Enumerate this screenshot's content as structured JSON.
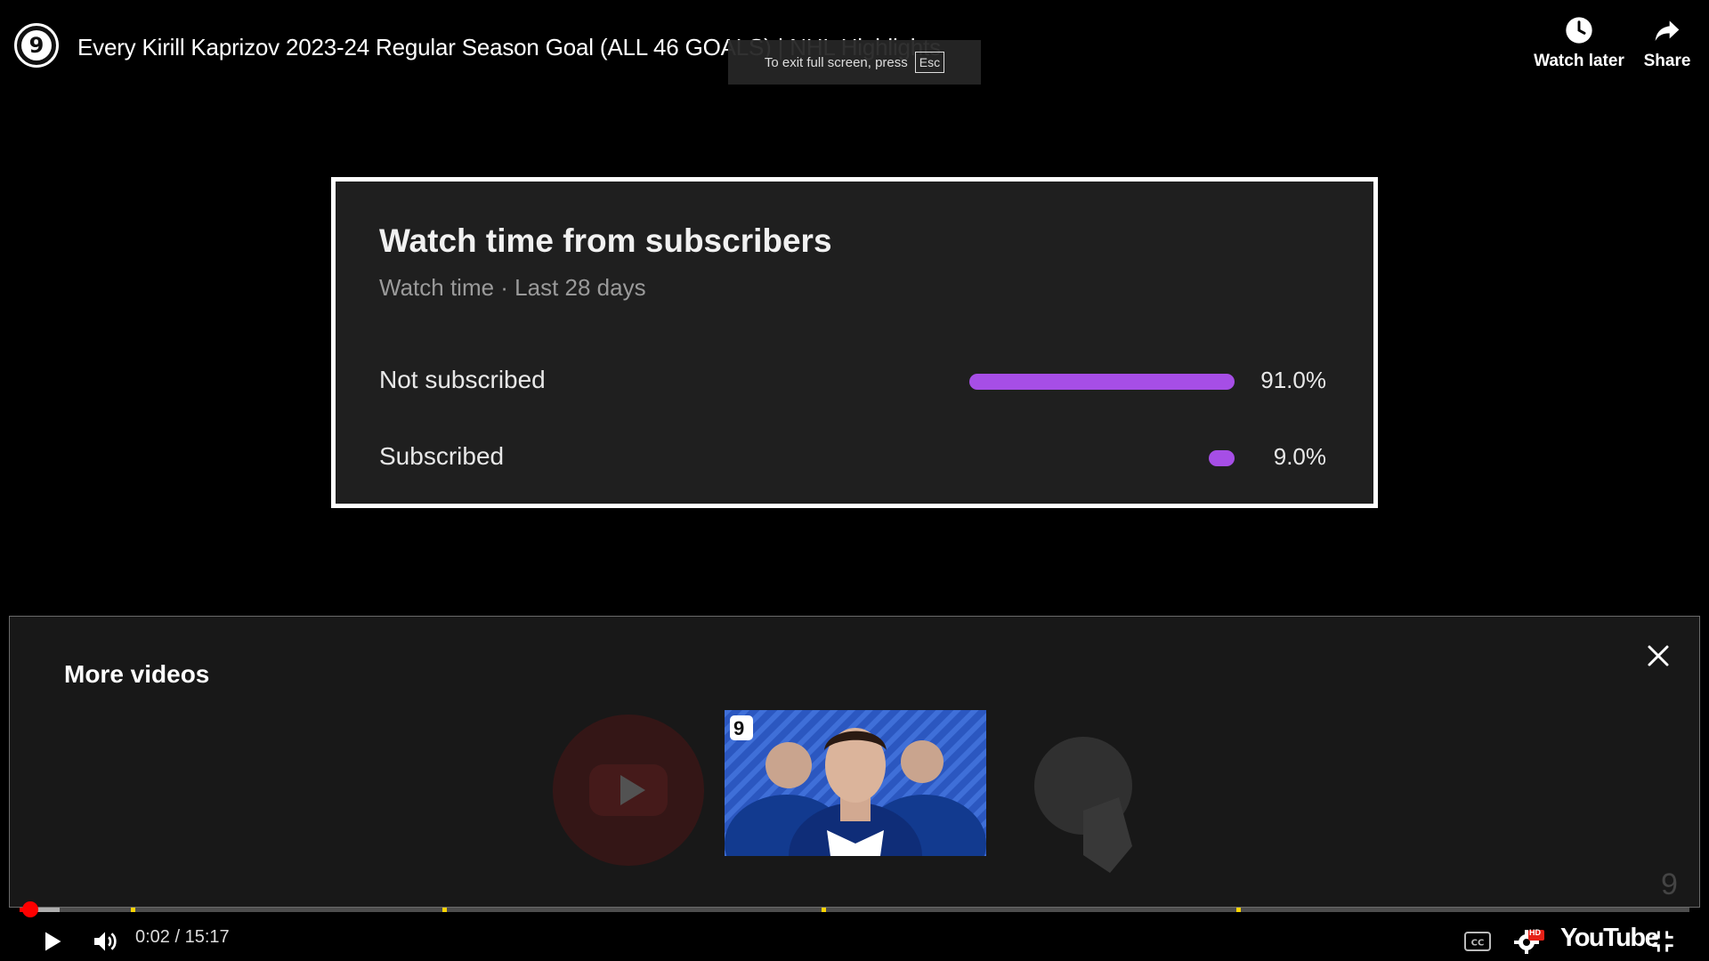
{
  "header": {
    "channel_logo_digit": "9",
    "video_title": "Every Kirill Kaprizov 2023-24 Regular Season Goal (ALL 46 GOALS) | NHL Highlights",
    "watch_later_label": "Watch later",
    "share_label": "Share"
  },
  "toast": {
    "text": "To exit full screen, press",
    "key": "Esc"
  },
  "stat_card": {
    "title": "Watch time from subscribers",
    "subtitle": "Watch time · Last 28 days",
    "rows": [
      {
        "label": "Not subscribed",
        "value": "91.0%",
        "fraction": 0.91
      },
      {
        "label": "Subscribed",
        "value": "9.0%",
        "fraction": 0.09
      }
    ],
    "bar_color": "#a64ee6"
  },
  "more_videos": {
    "title": "More videos",
    "thumbnail_badge": "9",
    "watermark": "9"
  },
  "player": {
    "time": "0:02 / 15:17",
    "progress_fraction": 0.002,
    "buffered_fraction": 0.024,
    "hd_badge": "HD",
    "wordmark": "YouTube",
    "accent": "#ff0000",
    "chapter_color": "#ffd400"
  }
}
